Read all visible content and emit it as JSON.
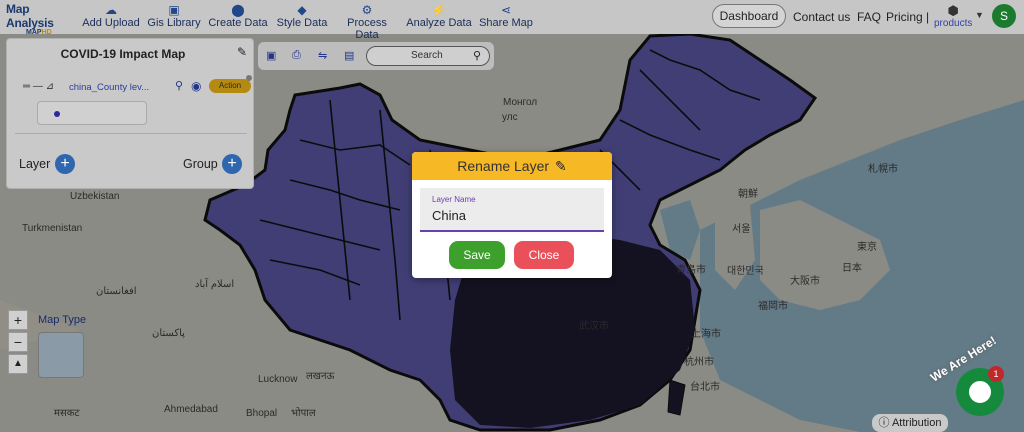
{
  "brand": {
    "title": "Map Analysis",
    "sub_prefix": "MAP",
    "sub_suffix": "HD"
  },
  "nav": [
    {
      "label": "Add Upload",
      "icon": "cloud-upload-icon"
    },
    {
      "label": "Gis Library",
      "icon": "library-icon"
    },
    {
      "label": "Create Data",
      "icon": "map-pin-icon"
    },
    {
      "label": "Style Data",
      "icon": "paint-bucket-icon"
    },
    {
      "label": "Process Data",
      "icon": "process-icon"
    },
    {
      "label": "Analyze Data",
      "icon": "analyze-icon"
    },
    {
      "label": "Share Map",
      "icon": "share-icon"
    }
  ],
  "top_right": {
    "dashboard": "Dashboard",
    "contact": "Contact us",
    "faq": "FAQ",
    "pricing": "Pricing |",
    "products": "products",
    "avatar_initial": "S"
  },
  "panel": {
    "title": "COVID-19 Impact Map",
    "layer_name": "china_County lev...",
    "action_label": "Action",
    "layer_label": "Layer",
    "group_label": "Group"
  },
  "toolbar": {
    "search_placeholder": "Search"
  },
  "map": {
    "map_type_label": "Map Type",
    "attribution": "Attribution",
    "labels": [
      "Монгол",
      "улс",
      "Uzbekistan",
      "Turkmenistan",
      "افغانستان",
      "اسلام آباد",
      "پاکستان",
      "Lucknow",
      "लखनऊ",
      "Bhopal",
      "भोपाल",
      "Ahmedabad",
      "मसकट",
      "札幌市",
      "日本",
      "東京",
      "大阪市",
      "福岡市",
      "대한민국",
      "서울",
      "青島市",
      "上海市",
      "武汉市",
      "杭州市",
      "台北市",
      "朝鮮"
    ]
  },
  "modal": {
    "title": "Rename Layer",
    "field_label": "Layer Name",
    "field_value": "China",
    "save_label": "Save",
    "close_label": "Close"
  },
  "chat": {
    "banner": "We Are Here!",
    "badge": "1"
  },
  "colors": {
    "china_fill": "#5d5aa8",
    "accent_orange": "#f6b824",
    "save_green": "#3da02c",
    "close_red": "#e9505a",
    "avatar_green": "#1c7a2e"
  }
}
